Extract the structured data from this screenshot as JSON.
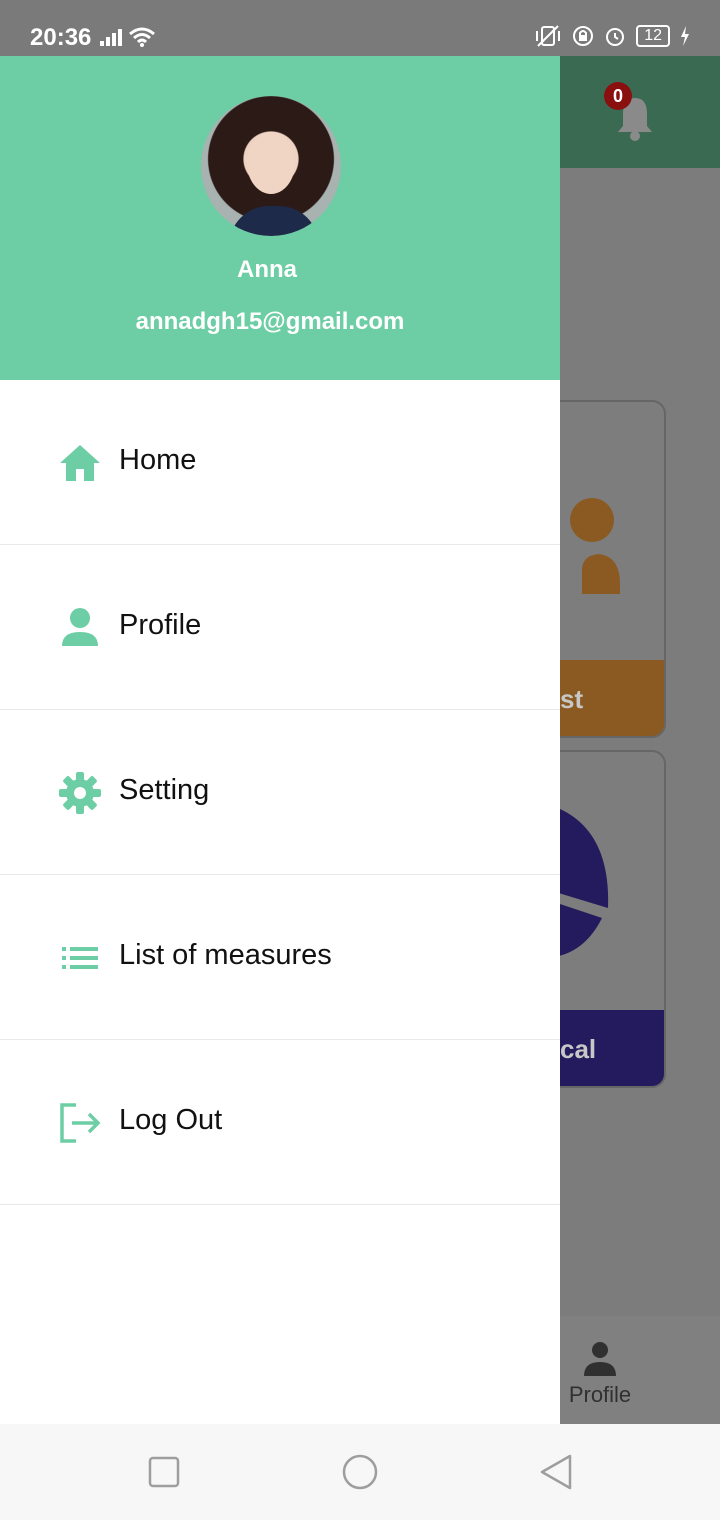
{
  "status_bar": {
    "time": "20:36",
    "battery": "12"
  },
  "app_behind": {
    "notification_count": "0",
    "card1_footer": "st",
    "card2_footer": "cal",
    "bottom_nav_profile": "Profile"
  },
  "drawer": {
    "user_name": "Anna",
    "user_email": "annadgh15@gmail.com",
    "accent_color": "#6dcda4",
    "items": [
      {
        "label": "Home",
        "icon": "home-icon"
      },
      {
        "label": "Profile",
        "icon": "person-icon"
      },
      {
        "label": "Setting",
        "icon": "gear-icon"
      },
      {
        "label": "List of measures",
        "icon": "list-icon"
      },
      {
        "label": "Log Out",
        "icon": "logout-icon"
      }
    ]
  }
}
